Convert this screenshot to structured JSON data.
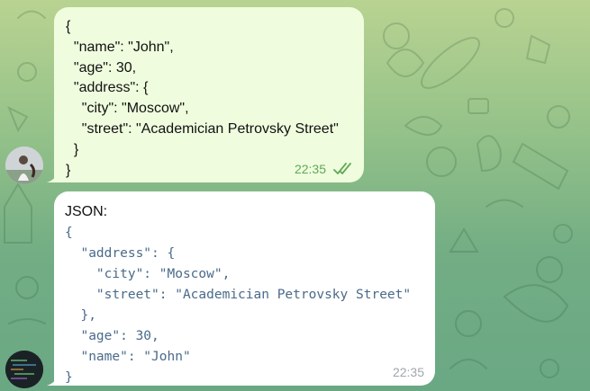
{
  "messages": [
    {
      "direction": "outgoing",
      "text": "{\n  \"name\": \"John\",\n  \"age\": 30,\n  \"address\": {\n    \"city\": \"Moscow\",\n    \"street\": \"Academician Petrovsky Street\"\n  }\n}",
      "time": "22:35",
      "status_icon": "double-check-icon",
      "colors": {
        "bubble": "#effdde",
        "time": "#5fa956"
      }
    },
    {
      "direction": "incoming",
      "label": "JSON:",
      "code": "{\n  \"address\": {\n    \"city\": \"Moscow\",\n    \"street\": \"Academician Petrovsky Street\"\n  },\n  \"age\": 30,\n  \"name\": \"John\"\n}",
      "time": "22:35",
      "colors": {
        "bubble": "#ffffff",
        "code": "#4a6a8a",
        "time": "#a0a6ab"
      }
    }
  ],
  "avatars": [
    "user-avatar",
    "bot-avatar"
  ],
  "theme": {
    "background_top": "#b9d391",
    "background_bottom": "#6aa884"
  }
}
